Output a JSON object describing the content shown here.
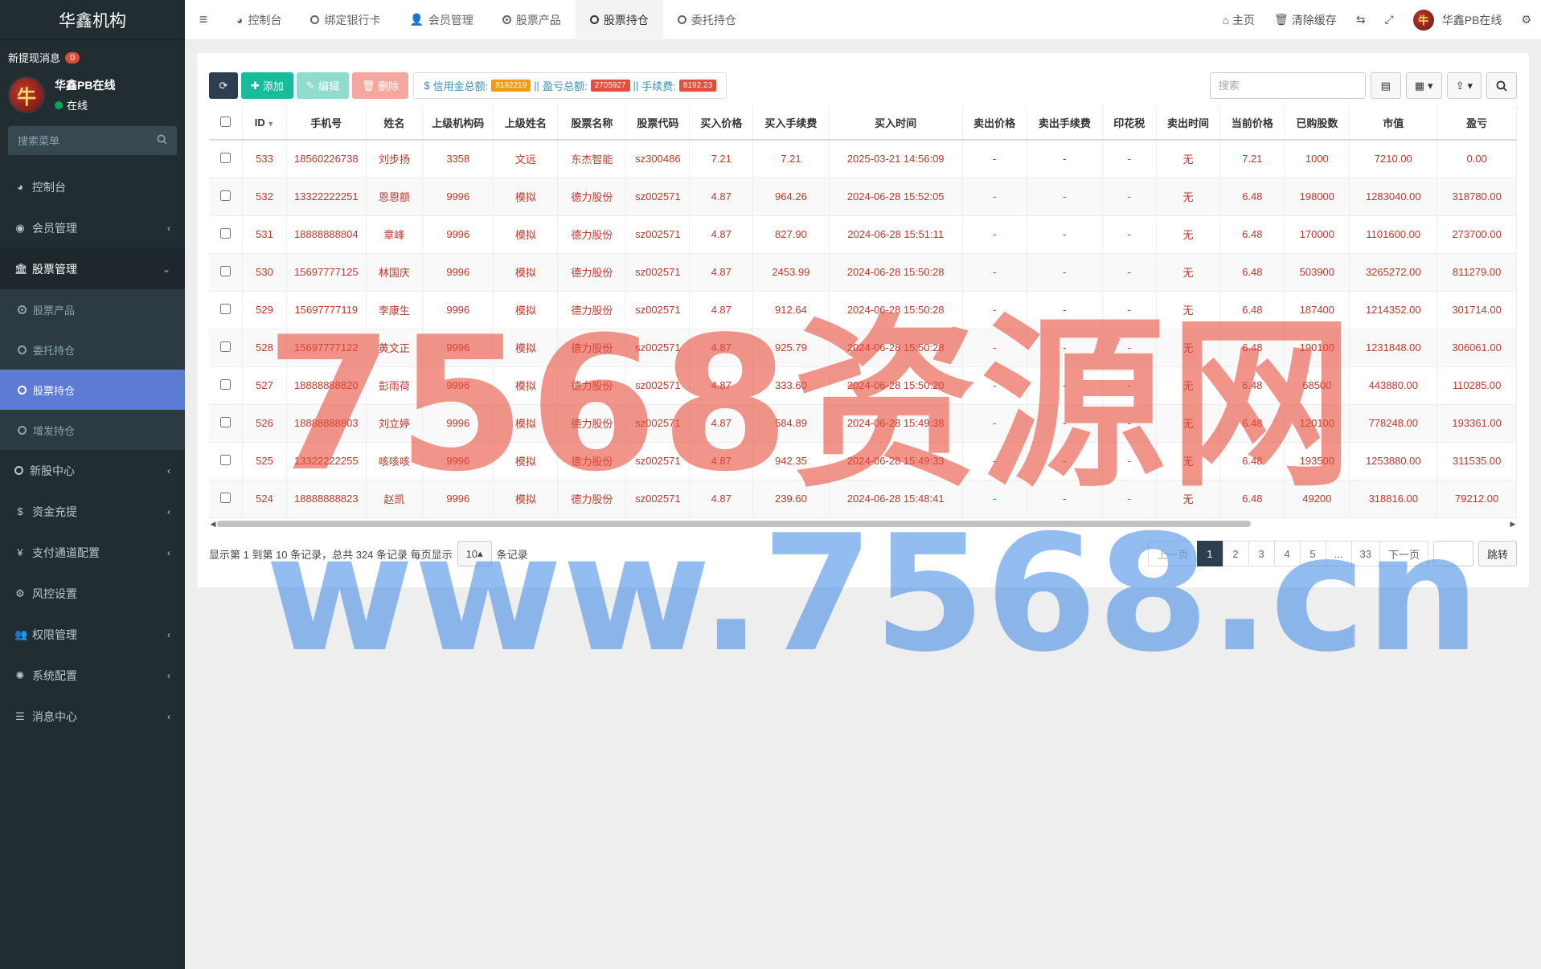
{
  "brand": "华鑫机构",
  "notice": {
    "label": "新提现消息",
    "count": "0"
  },
  "user": {
    "avatar_glyph": "牛",
    "name": "华鑫PB在线",
    "status": "在线"
  },
  "side_search": {
    "placeholder": "搜索菜单"
  },
  "menu": {
    "dashboard": "控制台",
    "members": "会员管理",
    "stocks": "股票管理",
    "stock_products": "股票产品",
    "entrust": "委托持仓",
    "holdings": "股票持仓",
    "placement": "增发持仓",
    "ipo": "新股中心",
    "funds": "资金充提",
    "payment": "支付通道配置",
    "risk": "风控设置",
    "perm": "权限管理",
    "sysconf": "系统配置",
    "msg": "消息中心"
  },
  "topnav": {
    "tabs": [
      "控制台",
      "绑定银行卡",
      "会员管理",
      "股票产品",
      "股票持仓",
      "委托持仓"
    ],
    "home": "主页",
    "clear_cache": "清除缓存",
    "username": "华鑫PB在线"
  },
  "toolbar": {
    "add": "添加",
    "edit": "编辑",
    "delete": "删除",
    "credit_label": "信用金总额:",
    "credit_value": "8192219",
    "pnl_label": "盈亏总额:",
    "pnl_value": "2705927",
    "fee_label": "手续费:",
    "fee_value": "8192.23",
    "search_placeholder": "搜索"
  },
  "table": {
    "headers": [
      "ID",
      "手机号",
      "姓名",
      "上级机构码",
      "上级姓名",
      "股票名称",
      "股票代码",
      "买入价格",
      "买入手续费",
      "买入时间",
      "卖出价格",
      "卖出手续费",
      "印花税",
      "卖出时间",
      "当前价格",
      "已购股数",
      "市值",
      "盈亏"
    ],
    "rows": [
      [
        "533",
        "18560226738",
        "刘步扬",
        "3358",
        "文远",
        "东杰智能",
        "sz300486",
        "7.21",
        "7.21",
        "2025-03-21 14:56:09",
        "-",
        "-",
        "-",
        "无",
        "7.21",
        "1000",
        "7210.00",
        "0.00"
      ],
      [
        "532",
        "13322222251",
        "恩恩额",
        "9996",
        "模拟",
        "德力股份",
        "sz002571",
        "4.87",
        "964.26",
        "2024-06-28 15:52:05",
        "-",
        "-",
        "-",
        "无",
        "6.48",
        "198000",
        "1283040.00",
        "318780.00"
      ],
      [
        "531",
        "18888888804",
        "章峰",
        "9996",
        "模拟",
        "德力股份",
        "sz002571",
        "4.87",
        "827.90",
        "2024-06-28 15:51:11",
        "-",
        "-",
        "-",
        "无",
        "6.48",
        "170000",
        "1101600.00",
        "273700.00"
      ],
      [
        "530",
        "15697777125",
        "林国庆",
        "9996",
        "模拟",
        "德力股份",
        "sz002571",
        "4.87",
        "2453.99",
        "2024-06-28 15:50:28",
        "-",
        "-",
        "-",
        "无",
        "6.48",
        "503900",
        "3265272.00",
        "811279.00"
      ],
      [
        "529",
        "15697777119",
        "李康生",
        "9996",
        "模拟",
        "德力股份",
        "sz002571",
        "4.87",
        "912.64",
        "2024-06-28 15:50:28",
        "-",
        "-",
        "-",
        "无",
        "6.48",
        "187400",
        "1214352.00",
        "301714.00"
      ],
      [
        "528",
        "15697777122",
        "黄文正",
        "9996",
        "模拟",
        "德力股份",
        "sz002571",
        "4.87",
        "925.79",
        "2024-06-28 15:50:28",
        "-",
        "-",
        "-",
        "无",
        "6.48",
        "190100",
        "1231848.00",
        "306061.00"
      ],
      [
        "527",
        "18888888820",
        "彭雨荷",
        "9996",
        "模拟",
        "德力股份",
        "sz002571",
        "4.87",
        "333.60",
        "2024-06-28 15:50:20",
        "-",
        "-",
        "-",
        "无",
        "6.48",
        "68500",
        "443880.00",
        "110285.00"
      ],
      [
        "526",
        "18888888803",
        "刘立婷",
        "9996",
        "模拟",
        "德力股份",
        "sz002571",
        "4.87",
        "584.89",
        "2024-06-28 15:49:38",
        "-",
        "-",
        "-",
        "无",
        "6.48",
        "120100",
        "778248.00",
        "193361.00"
      ],
      [
        "525",
        "13322222255",
        "咳咳咳",
        "9996",
        "模拟",
        "德力股份",
        "sz002571",
        "4.87",
        "942.35",
        "2024-06-28 15:49:33",
        "-",
        "-",
        "-",
        "无",
        "6.48",
        "193500",
        "1253880.00",
        "311535.00"
      ],
      [
        "524",
        "18888888823",
        "赵凯",
        "9996",
        "模拟",
        "德力股份",
        "sz002571",
        "4.87",
        "239.60",
        "2024-06-28 15:48:41",
        "-",
        "-",
        "-",
        "无",
        "6.48",
        "49200",
        "318816.00",
        "79212.00"
      ]
    ]
  },
  "footer": {
    "info_prefix": "显示第 1 到第 10 条记录，总共 324 条记录 每页显示",
    "page_size": "10",
    "info_suffix": "条记录",
    "prev": "上一页",
    "pages": [
      "1",
      "2",
      "3",
      "4",
      "5",
      "...",
      "33"
    ],
    "next": "下一页",
    "jump": "跳转"
  },
  "watermark": {
    "line1": "7568资源网",
    "line2": "www.7568.cn"
  },
  "colors": {
    "sidebar": "#222d32",
    "active_menu": "#5b7bd5",
    "cell_text": "#c0392b",
    "add": "#18bc9c"
  }
}
